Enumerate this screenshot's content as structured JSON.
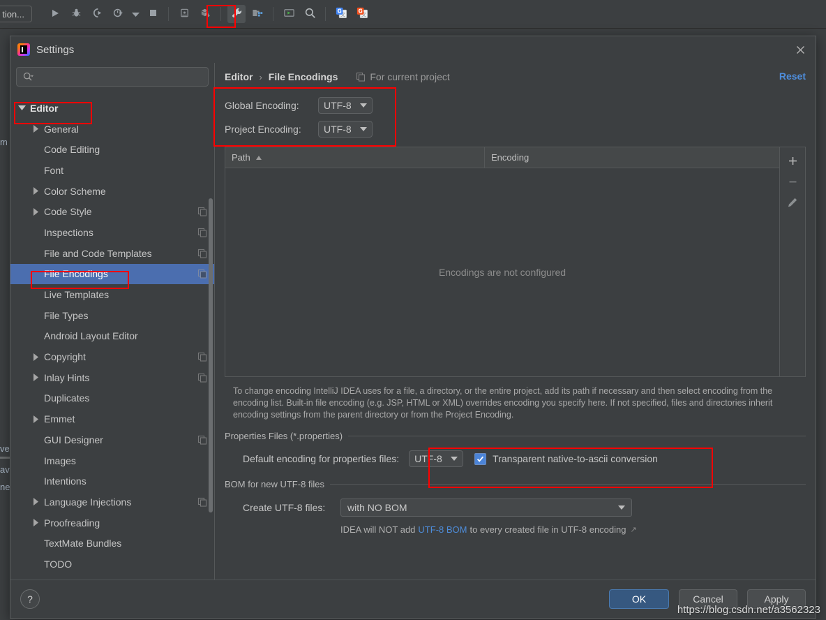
{
  "toolbar": {
    "run_config_label": "tion...",
    "buttons": [
      {
        "name": "run-button",
        "icon": "play-icon",
        "active": false
      },
      {
        "name": "debug-button",
        "icon": "bug-icon",
        "active": false
      },
      {
        "name": "run-coverage-button",
        "icon": "run-coverage-icon",
        "active": false
      },
      {
        "name": "profile-button",
        "icon": "profiler-icon",
        "active": false
      },
      {
        "name": "profile-dropdown",
        "icon": "chevron-down-icon",
        "active": false
      },
      {
        "name": "stop-button",
        "icon": "stop-square-icon",
        "active": false
      },
      {
        "name": "device-manager-button",
        "icon": "device-icon",
        "active": false
      },
      {
        "name": "sdk-download-button",
        "icon": "cube-down-icon",
        "active": false
      },
      {
        "name": "settings-button",
        "icon": "wrench-icon",
        "active": true
      },
      {
        "name": "project-structure-button",
        "icon": "project-structure-icon",
        "active": false
      },
      {
        "name": "terminal-button",
        "icon": "terminal-icon",
        "active": false
      },
      {
        "name": "search-everywhere-button",
        "icon": "search-icon",
        "active": false
      },
      {
        "name": "translate-button",
        "icon": "google-translate-icon",
        "active": false
      },
      {
        "name": "translate-alt-button",
        "icon": "google-translate-red-icon",
        "active": false
      }
    ]
  },
  "background_text": {
    "scrap_m": "m",
    "scrap_ve": "ve",
    "scrap_av": "av",
    "scrap_ne": "ne"
  },
  "dialog": {
    "title": "Settings",
    "close_icon": "close-icon",
    "search": {
      "placeholder": "",
      "value": "",
      "icon": "search-icon"
    },
    "tree_scrap": "",
    "tree": [
      {
        "label": "Editor",
        "expanded": true,
        "arrow": "down",
        "bold": true,
        "copy": false,
        "selected": false,
        "indent": 0
      },
      {
        "label": "General",
        "expanded": false,
        "arrow": "right",
        "bold": false,
        "copy": false,
        "selected": false,
        "indent": 1
      },
      {
        "label": "Code Editing",
        "expanded": false,
        "arrow": "none",
        "bold": false,
        "copy": false,
        "selected": false,
        "indent": 1
      },
      {
        "label": "Font",
        "expanded": false,
        "arrow": "none",
        "bold": false,
        "copy": false,
        "selected": false,
        "indent": 1
      },
      {
        "label": "Color Scheme",
        "expanded": false,
        "arrow": "right",
        "bold": false,
        "copy": false,
        "selected": false,
        "indent": 1
      },
      {
        "label": "Code Style",
        "expanded": false,
        "arrow": "right",
        "bold": false,
        "copy": true,
        "selected": false,
        "indent": 1
      },
      {
        "label": "Inspections",
        "expanded": false,
        "arrow": "none",
        "bold": false,
        "copy": true,
        "selected": false,
        "indent": 1
      },
      {
        "label": "File and Code Templates",
        "expanded": false,
        "arrow": "none",
        "bold": false,
        "copy": true,
        "selected": false,
        "indent": 1
      },
      {
        "label": "File Encodings",
        "expanded": false,
        "arrow": "none",
        "bold": false,
        "copy": true,
        "selected": true,
        "indent": 1
      },
      {
        "label": "Live Templates",
        "expanded": false,
        "arrow": "none",
        "bold": false,
        "copy": false,
        "selected": false,
        "indent": 1
      },
      {
        "label": "File Types",
        "expanded": false,
        "arrow": "none",
        "bold": false,
        "copy": false,
        "selected": false,
        "indent": 1
      },
      {
        "label": "Android Layout Editor",
        "expanded": false,
        "arrow": "none",
        "bold": false,
        "copy": false,
        "selected": false,
        "indent": 1
      },
      {
        "label": "Copyright",
        "expanded": false,
        "arrow": "right",
        "bold": false,
        "copy": true,
        "selected": false,
        "indent": 1
      },
      {
        "label": "Inlay Hints",
        "expanded": false,
        "arrow": "right",
        "bold": false,
        "copy": true,
        "selected": false,
        "indent": 1
      },
      {
        "label": "Duplicates",
        "expanded": false,
        "arrow": "none",
        "bold": false,
        "copy": false,
        "selected": false,
        "indent": 1
      },
      {
        "label": "Emmet",
        "expanded": false,
        "arrow": "right",
        "bold": false,
        "copy": false,
        "selected": false,
        "indent": 1
      },
      {
        "label": "GUI Designer",
        "expanded": false,
        "arrow": "none",
        "bold": false,
        "copy": true,
        "selected": false,
        "indent": 1
      },
      {
        "label": "Images",
        "expanded": false,
        "arrow": "none",
        "bold": false,
        "copy": false,
        "selected": false,
        "indent": 1
      },
      {
        "label": "Intentions",
        "expanded": false,
        "arrow": "none",
        "bold": false,
        "copy": false,
        "selected": false,
        "indent": 1
      },
      {
        "label": "Language Injections",
        "expanded": false,
        "arrow": "right",
        "bold": false,
        "copy": true,
        "selected": false,
        "indent": 1
      },
      {
        "label": "Proofreading",
        "expanded": false,
        "arrow": "right",
        "bold": false,
        "copy": false,
        "selected": false,
        "indent": 1
      },
      {
        "label": "TextMate Bundles",
        "expanded": false,
        "arrow": "none",
        "bold": false,
        "copy": false,
        "selected": false,
        "indent": 1
      },
      {
        "label": "TODO",
        "expanded": false,
        "arrow": "none",
        "bold": false,
        "copy": false,
        "selected": false,
        "indent": 1
      }
    ],
    "breadcrumb": {
      "parent": "Editor",
      "separator": "›",
      "current": "File Encodings",
      "scope_label": "For current project",
      "scope_icon": "copy-scope-icon"
    },
    "reset_label": "Reset",
    "encoding": {
      "global_label": "Global Encoding:",
      "global_value": "UTF-8",
      "project_label": "Project Encoding:",
      "project_value": "UTF-8"
    },
    "table": {
      "col_path": "Path",
      "col_encoding": "Encoding",
      "sort_direction": "asc",
      "empty_text": "Encodings are not configured",
      "rows": [],
      "actions": [
        {
          "name": "add-row-button",
          "icon": "plus-icon",
          "label": "+"
        },
        {
          "name": "remove-row-button",
          "icon": "minus-icon",
          "label": "–"
        },
        {
          "name": "edit-row-button",
          "icon": "pencil-icon",
          "label": ""
        }
      ]
    },
    "hint_text": "To change encoding IntelliJ IDEA uses for a file, a directory, or the entire project, add its path if necessary and then select encoding from the encoding list. Built-in file encoding (e.g. JSP, HTML or XML) overrides encoding you specify here. If not specified, files and directories inherit encoding settings from the parent directory or from the Project Encoding.",
    "properties_group": {
      "title": "Properties Files (*.properties)",
      "default_encoding_label": "Default encoding for properties files:",
      "default_encoding_value": "UTF-8",
      "transparent_label": "Transparent native-to-ascii conversion",
      "transparent_checked": true
    },
    "bom_group": {
      "title": "BOM for new UTF-8 files",
      "create_label": "Create UTF-8 files:",
      "create_value": "with NO BOM",
      "note_prefix": "IDEA will NOT add",
      "note_link": "UTF-8 BOM",
      "note_suffix": "to every created file in UTF-8 encoding",
      "external_link_icon": "external-link-icon"
    },
    "footer": {
      "help_label": "?",
      "ok_label": "OK",
      "cancel_label": "Cancel",
      "apply_label": "Apply"
    }
  },
  "watermark": "https://blog.csdn.net/a3562323",
  "colors": {
    "dialog_bg": "#3c3f41",
    "selection_blue": "#4b6eaf",
    "accent_link": "#4e8ddb",
    "annotation_red": "#ff0000",
    "ok_button": "#365880",
    "checkbox_blue": "#4b84d8"
  }
}
